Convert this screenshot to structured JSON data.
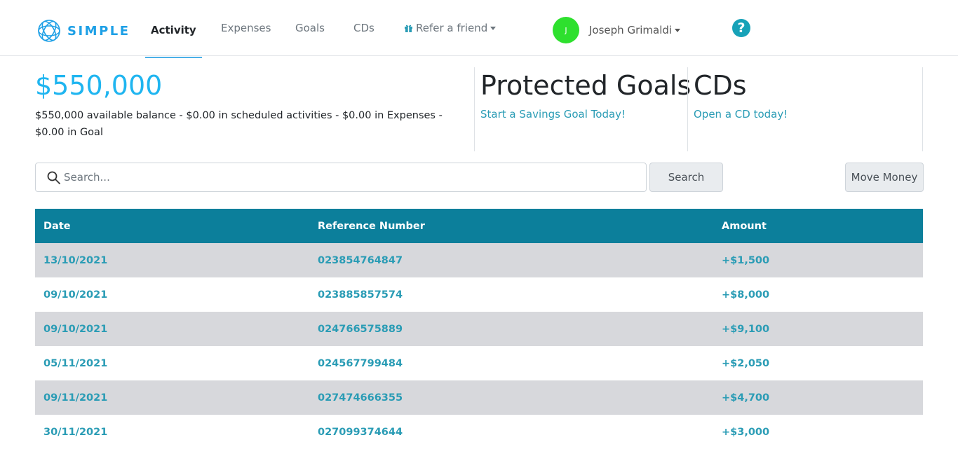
{
  "brand": {
    "name": "SIMPLE",
    "logo_icon": "simple-logo-icon",
    "color": "#1ea0e6"
  },
  "nav": {
    "activity": "Activity",
    "expenses": "Expenses",
    "goals": "Goals",
    "cds": "CDs",
    "refer": "Refer a friend"
  },
  "user": {
    "initial": "J",
    "name": "Joseph Grimaldi",
    "avatar_color": "#2ee02e"
  },
  "help_icon": "?",
  "summary": {
    "balance": "$550,000",
    "description": "$550,000 available balance - $0.00 in scheduled activities - $0.00 in Expenses - $0.00 in Goal",
    "goals_title": "Protected Goals",
    "goals_link": "Start a Savings Goal Today!",
    "cds_title": "CDs",
    "cds_link": "Open a CD today!"
  },
  "search": {
    "placeholder": "Search...",
    "button": "Search"
  },
  "move_money": "Move Money",
  "table": {
    "headers": {
      "date": "Date",
      "reference": "Reference Number",
      "amount": "Amount"
    },
    "rows": [
      {
        "date": "13/10/2021",
        "reference": "023854764847",
        "amount": "+$1,500"
      },
      {
        "date": "09/10/2021",
        "reference": "023885857574",
        "amount": "+$8,000"
      },
      {
        "date": "09/10/2021",
        "reference": "024766575889",
        "amount": "+$9,100"
      },
      {
        "date": "05/11/2021",
        "reference": "024567799484",
        "amount": "+$2,050"
      },
      {
        "date": "09/11/2021",
        "reference": "027474666355",
        "amount": "+$4,700"
      },
      {
        "date": "30/11/2021",
        "reference": "027099374644",
        "amount": "+$3,000"
      }
    ]
  },
  "colors": {
    "accent": "#1fb5f0",
    "link": "#2a9cb5",
    "table_header": "#0c7f9b",
    "row_stripe": "#d7d8dc"
  }
}
